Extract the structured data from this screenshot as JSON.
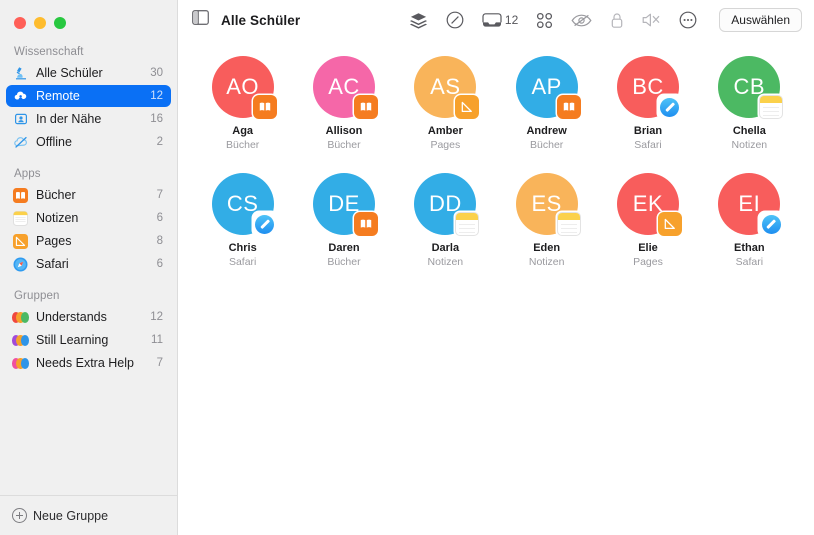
{
  "window": {
    "traffic_lights": [
      "close",
      "minimize",
      "zoom"
    ]
  },
  "sidebar": {
    "sections": [
      {
        "header": "Wissenschaft",
        "items": [
          {
            "label": "Alle Schüler",
            "count": "30",
            "icon": "microscope-icon",
            "selected": false
          },
          {
            "label": "Remote",
            "count": "12",
            "icon": "cloud-person-icon",
            "selected": true
          },
          {
            "label": "In der Nähe",
            "count": "16",
            "icon": "person-card-icon",
            "selected": false
          },
          {
            "label": "Offline",
            "count": "2",
            "icon": "cloud-slash-icon",
            "selected": false
          }
        ]
      },
      {
        "header": "Apps",
        "items": [
          {
            "label": "Bücher",
            "count": "7",
            "icon": "books-app-icon",
            "selected": false
          },
          {
            "label": "Notizen",
            "count": "6",
            "icon": "notes-app-icon",
            "selected": false
          },
          {
            "label": "Pages",
            "count": "8",
            "icon": "pages-app-icon",
            "selected": false
          },
          {
            "label": "Safari",
            "count": "6",
            "icon": "safari-app-icon",
            "selected": false
          }
        ]
      },
      {
        "header": "Gruppen",
        "items": [
          {
            "label": "Understands",
            "count": "12",
            "icon": "group-dots-icon",
            "selected": false,
            "dot_color": "#f0483e"
          },
          {
            "label": "Still Learning",
            "count": "11",
            "icon": "group-dots-icon",
            "selected": false,
            "dot_color": "#a24bd8"
          },
          {
            "label": "Needs Extra Help",
            "count": "7",
            "icon": "group-dots-icon",
            "selected": false,
            "dot_color": "#f050a0"
          }
        ]
      }
    ],
    "footer": {
      "label": "Neue Gruppe",
      "icon": "plus-circle-icon"
    }
  },
  "toolbar": {
    "sidebar_toggle_icon": "sidebar-toggle-icon",
    "title": "Alle Schüler",
    "actions": [
      {
        "name": "layers-icon",
        "label": ""
      },
      {
        "name": "navigate-icon",
        "label": ""
      },
      {
        "name": "inbox-icon",
        "label": "12"
      },
      {
        "name": "grid-icon",
        "label": ""
      },
      {
        "name": "eye-slash-icon",
        "label": ""
      },
      {
        "name": "lock-icon",
        "label": ""
      },
      {
        "name": "mute-icon",
        "label": ""
      },
      {
        "name": "more-icon",
        "label": ""
      }
    ],
    "select_button": "Auswählen"
  },
  "students": [
    {
      "initials": "AO",
      "name": "Aga",
      "app": "Bücher",
      "color": "#f85d5c",
      "badge": "books"
    },
    {
      "initials": "AC",
      "name": "Allison",
      "app": "Bücher",
      "color": "#f567a8",
      "badge": "books"
    },
    {
      "initials": "AS",
      "name": "Amber",
      "app": "Pages",
      "color": "#f9b45a",
      "badge": "pages"
    },
    {
      "initials": "AP",
      "name": "Andrew",
      "app": "Bücher",
      "color": "#32ade6",
      "badge": "books"
    },
    {
      "initials": "BC",
      "name": "Brian",
      "app": "Safari",
      "color": "#f85d5c",
      "badge": "safari"
    },
    {
      "initials": "CB",
      "name": "Chella",
      "app": "Notizen",
      "color": "#4cb963",
      "badge": "notes"
    },
    {
      "initials": "CS",
      "name": "Chris",
      "app": "Safari",
      "color": "#32ade6",
      "badge": "safari"
    },
    {
      "initials": "DE",
      "name": "Daren",
      "app": "Bücher",
      "color": "#32ade6",
      "badge": "books"
    },
    {
      "initials": "DD",
      "name": "Darla",
      "app": "Notizen",
      "color": "#32ade6",
      "badge": "notes"
    },
    {
      "initials": "ES",
      "name": "Eden",
      "app": "Notizen",
      "color": "#f9b45a",
      "badge": "notes"
    },
    {
      "initials": "EK",
      "name": "Elie",
      "app": "Pages",
      "color": "#f85d5c",
      "badge": "pages"
    },
    {
      "initials": "EI",
      "name": "Ethan",
      "app": "Safari",
      "color": "#f85d5c",
      "badge": "safari"
    }
  ],
  "colors": {
    "selection_blue": "#0a70f5",
    "sidebar_bg": "#f0f0f0",
    "accent_orange": "#f57c20"
  }
}
